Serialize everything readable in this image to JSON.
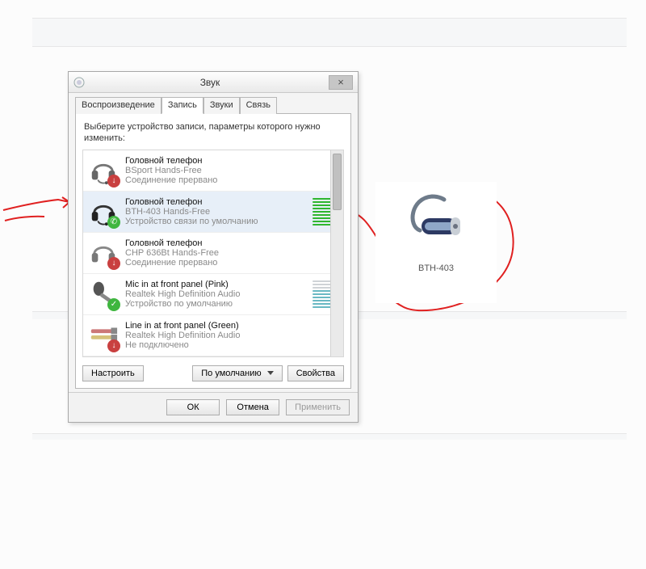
{
  "dialog": {
    "title": "Звук",
    "tabs": [
      {
        "label": "Воспроизведение"
      },
      {
        "label": "Запись"
      },
      {
        "label": "Звуки"
      },
      {
        "label": "Связь"
      }
    ],
    "activeTab": 1,
    "instruction": "Выберите устройство записи, параметры которого нужно изменить:",
    "devices": [
      {
        "title": "Головной телефон",
        "sub": "BSport Hands-Free",
        "status": "Соединение прервано",
        "iconKind": "headset",
        "badge": "down",
        "level": null
      },
      {
        "title": "Головной телефон",
        "sub": "BTH-403 Hands-Free",
        "status": "Устройство связи по умолчанию",
        "iconKind": "headset",
        "badge": "phone",
        "level": {
          "color": "green",
          "filled": 9,
          "total": 9
        },
        "selected": true
      },
      {
        "title": "Головной телефон",
        "sub": "CHP 636Bt Hands-Free",
        "status": "Соединение прервано",
        "iconKind": "headset",
        "badge": "down",
        "level": null
      },
      {
        "title": "Mic in at front panel (Pink)",
        "sub": "Realtek High Definition Audio",
        "status": "Устройство по умолчанию",
        "iconKind": "mic",
        "badge": "ok",
        "level": {
          "color": "teal",
          "filled": 6,
          "total": 9
        }
      },
      {
        "title": "Line in at front panel (Green)",
        "sub": "Realtek High Definition Audio",
        "status": "Не подключено",
        "iconKind": "linein",
        "badge": "down",
        "level": null
      }
    ],
    "buttons": {
      "configure": "Настроить",
      "default": "По умолчанию",
      "properties": "Свойства",
      "ok": "ОК",
      "cancel": "Отмена",
      "apply": "Применить"
    }
  },
  "bt_card": {
    "label": "BTH-403"
  }
}
